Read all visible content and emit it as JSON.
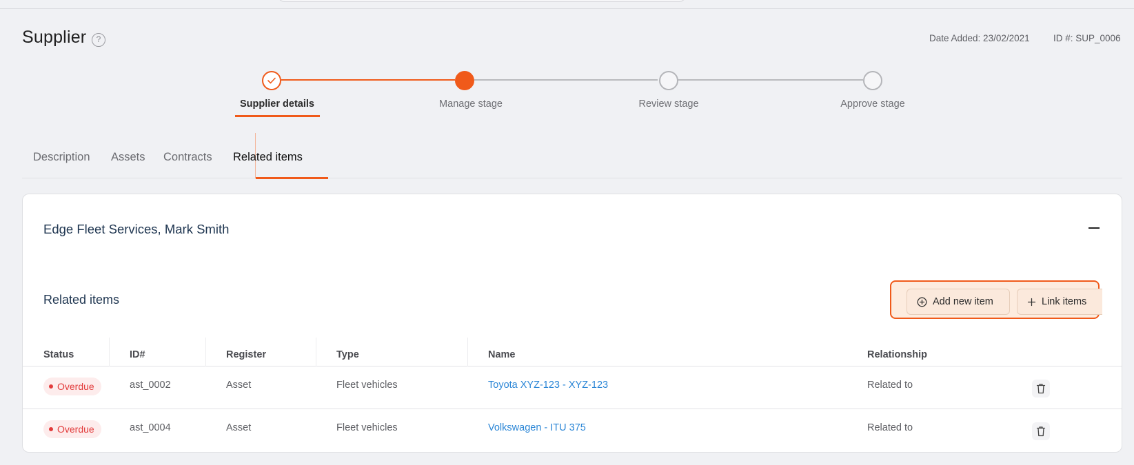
{
  "header": {
    "title": "Supplier",
    "help_glyph": "?",
    "date_added": "Date Added: 23/02/2021",
    "id": "ID #: SUP_0006"
  },
  "stepper": {
    "steps": [
      {
        "label": "Supplier details",
        "state": "done"
      },
      {
        "label": "Manage stage",
        "state": "current"
      },
      {
        "label": "Review stage",
        "state": "pending"
      },
      {
        "label": "Approve stage",
        "state": "pending"
      }
    ]
  },
  "tabs": [
    {
      "label": "Description"
    },
    {
      "label": "Assets"
    },
    {
      "label": "Contracts"
    },
    {
      "label": "Related items",
      "active": true
    }
  ],
  "card": {
    "title": "Edge Fleet Services, Mark Smith",
    "section_title": "Related items",
    "buttons": {
      "add_new": "Add new item",
      "link_items": "Link items"
    }
  },
  "table": {
    "columns": [
      "Status",
      "ID#",
      "Register",
      "Type",
      "Name",
      "Relationship"
    ],
    "rows": [
      {
        "status": "Overdue",
        "id": "ast_0002",
        "register": "Asset",
        "type": "Fleet vehicles",
        "name": "Toyota XYZ-123 - XYZ-123",
        "relationship": "Related to"
      },
      {
        "status": "Overdue",
        "id": "ast_0004",
        "register": "Asset",
        "type": "Fleet vehicles",
        "name": "Volkswagen - ITU 375",
        "relationship": "Related to"
      }
    ]
  },
  "colors": {
    "accent": "#f05a1a",
    "link": "#2b86d6",
    "overdue": "#e23b3b",
    "title_navy": "#1e3550"
  },
  "icons": [
    "help-icon",
    "check-icon",
    "minus-icon",
    "plus-circle-icon",
    "plus-icon",
    "trash-icon"
  ]
}
